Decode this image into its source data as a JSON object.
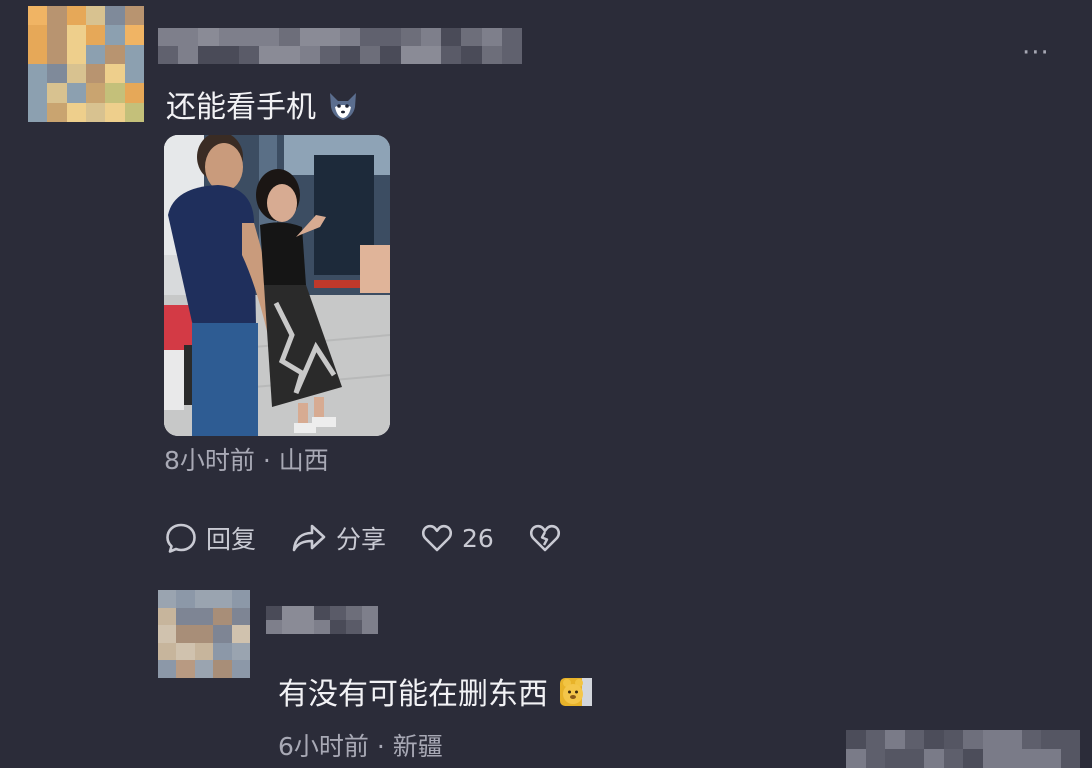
{
  "comments": [
    {
      "text": "还能看手机",
      "emoji": "fox-face-emoji",
      "time": "8小时前",
      "separator": "·",
      "location": "山西",
      "has_image": true,
      "actions": {
        "reply_label": "回复",
        "share_label": "分享",
        "like_count": "26"
      }
    },
    {
      "text": "有没有可能在删东西",
      "emoji": "bear-emoji",
      "time": "6小时前",
      "separator": "·",
      "location": "新疆"
    }
  ],
  "icons": {
    "more": "more-options-icon",
    "reply": "comment-bubble-icon",
    "share": "share-arrow-icon",
    "like": "heart-icon",
    "dislike": "broken-heart-icon"
  },
  "colors": {
    "background": "#2b2c39",
    "text": "#f2f2f5",
    "meta": "#a8a9b5"
  }
}
